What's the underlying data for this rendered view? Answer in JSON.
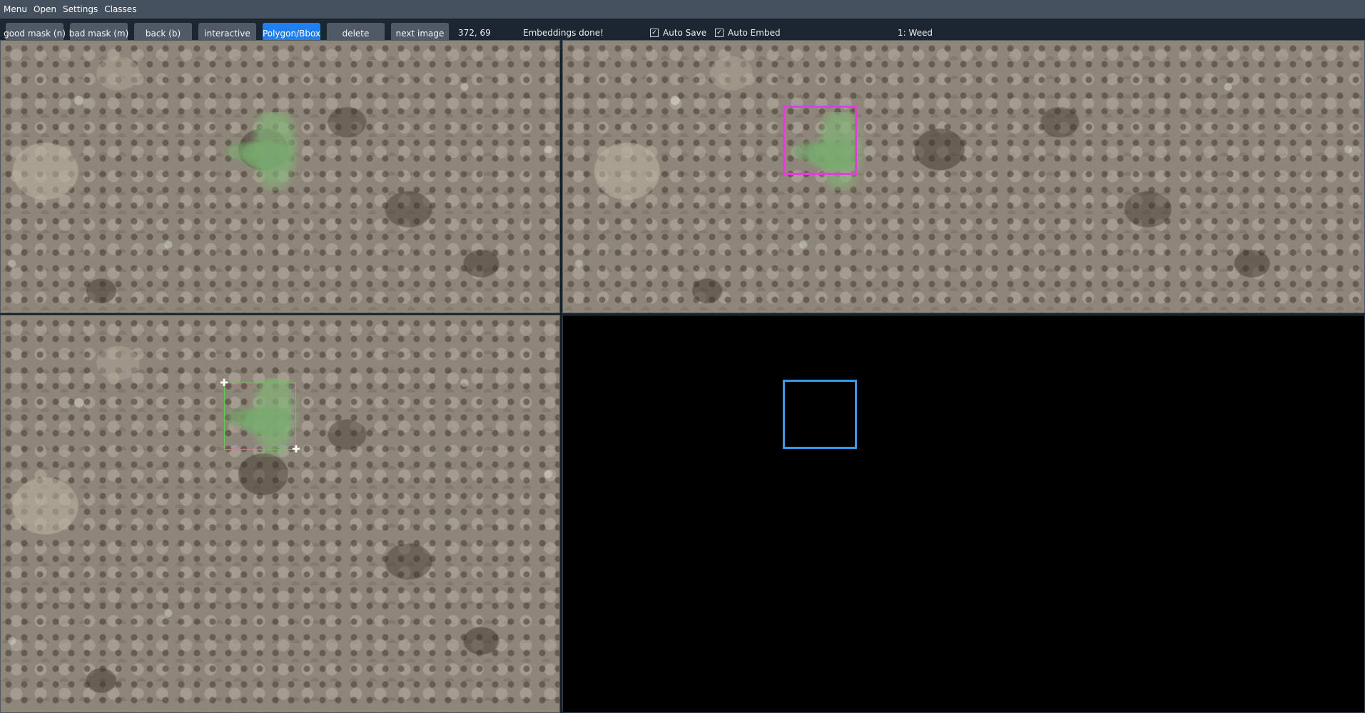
{
  "menu": {
    "items": [
      "Menu",
      "Open",
      "Settings",
      "Classes"
    ]
  },
  "toolbar": {
    "buttons": {
      "good_mask": "good mask (n)",
      "bad_mask": "bad mask (m)",
      "back": "back (b)",
      "interactive": "interactive",
      "polygon_bbox": "Polygon/Bbox",
      "delete": "delete",
      "next_image": "next image"
    },
    "active_button": "Polygon/Bbox",
    "coordinates": "372, 69",
    "status": "Embeddings done!",
    "auto_save": {
      "label": "Auto Save",
      "checked": true
    },
    "auto_embed": {
      "label": "Auto Embed",
      "checked": true
    },
    "current_class": "1: Weed"
  },
  "colors": {
    "menubar_bg": "#44505e",
    "toolbar_bg": "#1c2631",
    "button_bg": "#4f5a66",
    "button_active": "#1f7ff0",
    "bbox_prediction": "#e23fd8",
    "bbox_edit": "#6fbf55",
    "bbox_mask": "#3a9be0",
    "handle": "#ffffff"
  },
  "panes": [
    "image-view",
    "prediction-view",
    "edit-view",
    "mask-view"
  ]
}
